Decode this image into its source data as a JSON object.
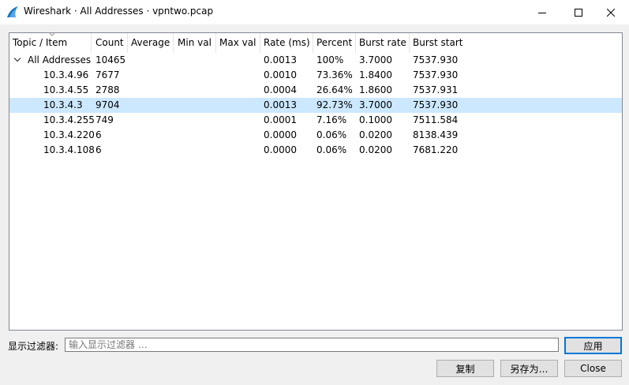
{
  "window": {
    "title": "Wireshark · All Addresses · vpntwo.pcap",
    "colors": {
      "accent": "#0078d7",
      "selection": "#cce8ff",
      "titlebar_bg": "#ffffff",
      "dialog_bg": "#f0f0f0"
    }
  },
  "table": {
    "columns": [
      "Topic / Item",
      "Count",
      "Average",
      "Min val",
      "Max val",
      "Rate (ms)",
      "Percent",
      "Burst rate",
      "Burst start"
    ],
    "rows": [
      {
        "topic": "All Addresses",
        "count": "10465",
        "average": "",
        "min": "",
        "max": "",
        "rate": "0.0013",
        "percent": "100%",
        "burst_rate": "3.7000",
        "burst_start": "7537.930",
        "level": 0,
        "expanded": true,
        "selected": false
      },
      {
        "topic": "10.3.4.96",
        "count": "7677",
        "average": "",
        "min": "",
        "max": "",
        "rate": "0.0010",
        "percent": "73.36%",
        "burst_rate": "1.8400",
        "burst_start": "7537.930",
        "level": 1,
        "selected": false
      },
      {
        "topic": "10.3.4.55",
        "count": "2788",
        "average": "",
        "min": "",
        "max": "",
        "rate": "0.0004",
        "percent": "26.64%",
        "burst_rate": "1.8600",
        "burst_start": "7537.931",
        "level": 1,
        "selected": false
      },
      {
        "topic": "10.3.4.3",
        "count": "9704",
        "average": "",
        "min": "",
        "max": "",
        "rate": "0.0013",
        "percent": "92.73%",
        "burst_rate": "3.7000",
        "burst_start": "7537.930",
        "level": 1,
        "selected": true
      },
      {
        "topic": "10.3.4.255",
        "count": "749",
        "average": "",
        "min": "",
        "max": "",
        "rate": "0.0001",
        "percent": "7.16%",
        "burst_rate": "0.1000",
        "burst_start": "7511.584",
        "level": 1,
        "selected": false
      },
      {
        "topic": "10.3.4.220",
        "count": "6",
        "average": "",
        "min": "",
        "max": "",
        "rate": "0.0000",
        "percent": "0.06%",
        "burst_rate": "0.0200",
        "burst_start": "8138.439",
        "level": 1,
        "selected": false
      },
      {
        "topic": "10.3.4.108",
        "count": "6",
        "average": "",
        "min": "",
        "max": "",
        "rate": "0.0000",
        "percent": "0.06%",
        "burst_rate": "0.0200",
        "burst_start": "7681.220",
        "level": 1,
        "selected": false
      }
    ]
  },
  "filter": {
    "label": "显示过滤器:",
    "placeholder": "输入显示过滤器 …",
    "value": "",
    "apply_label": "应用"
  },
  "buttons": {
    "copy": "复制",
    "save_as": "另存为…",
    "close": "Close"
  }
}
